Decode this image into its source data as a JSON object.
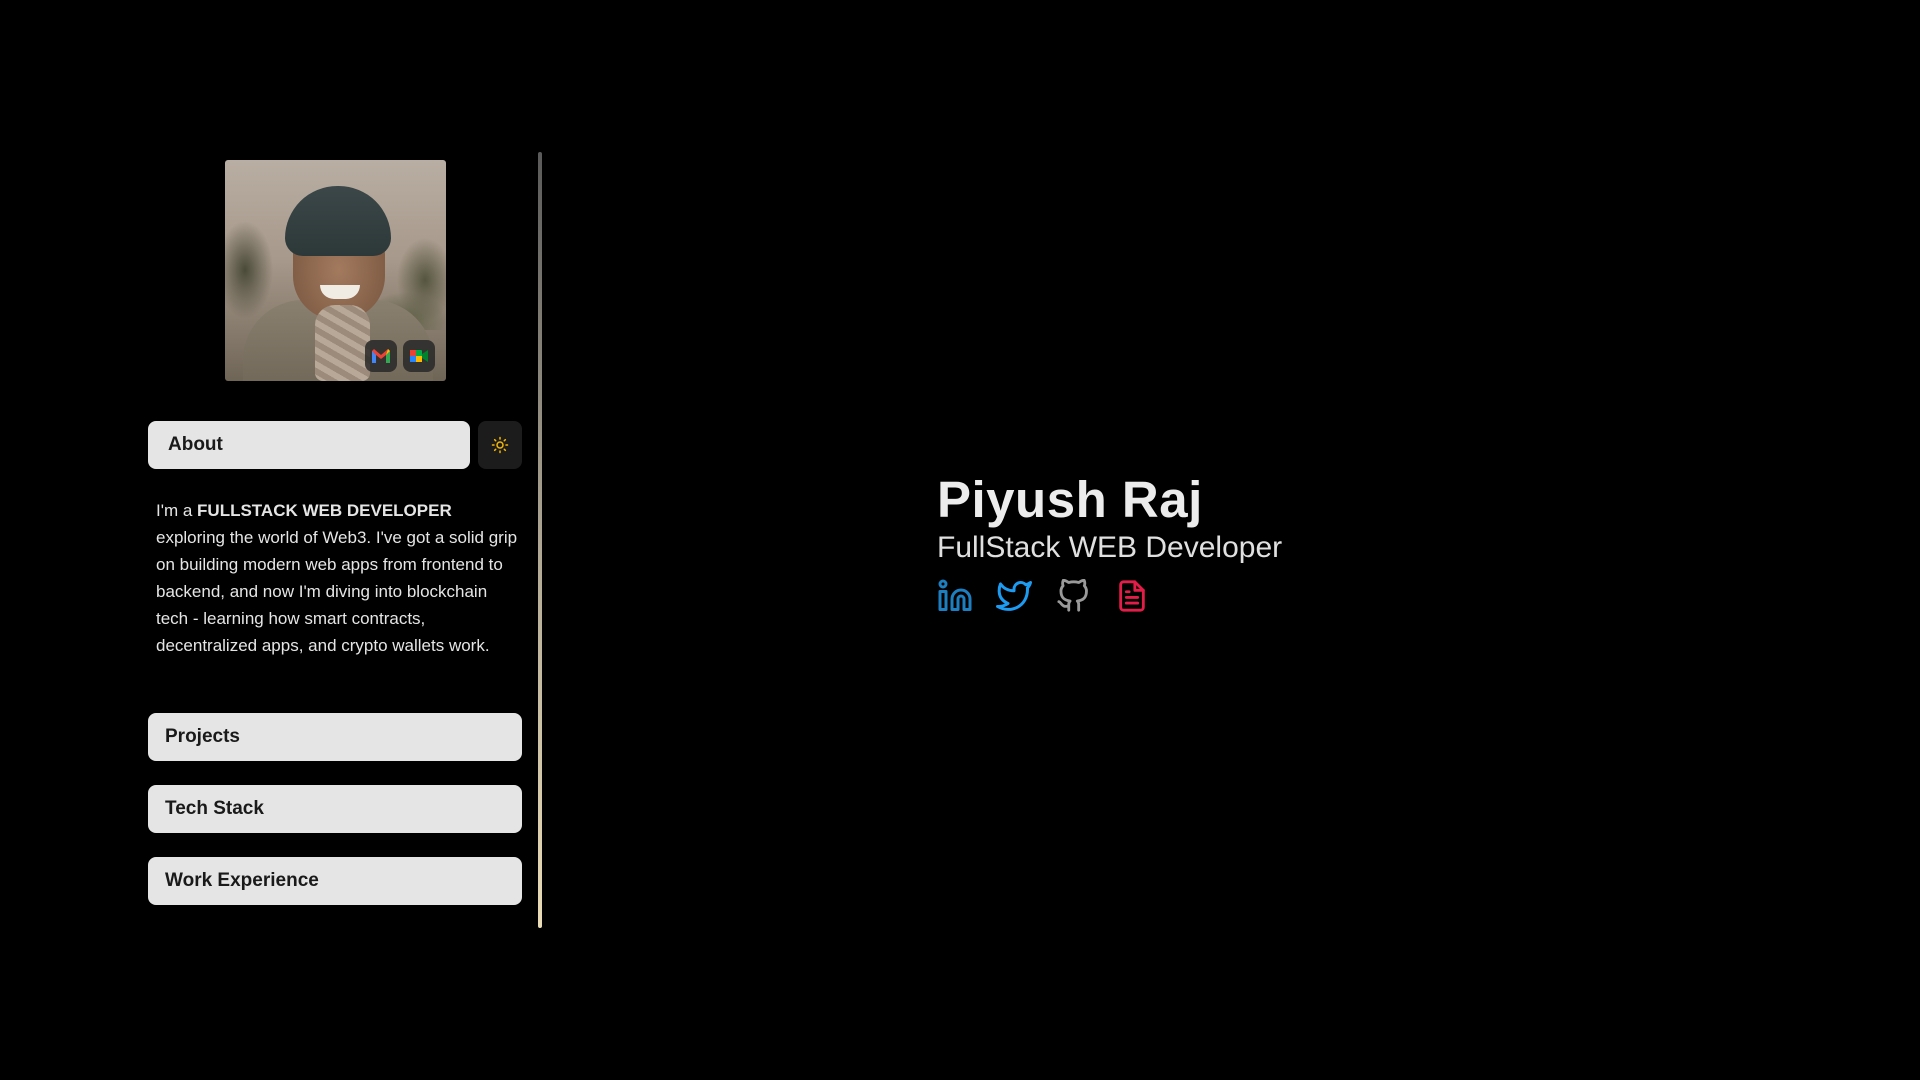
{
  "sidebar": {
    "about_label": "About",
    "about_text_prefix": "I'm a ",
    "about_text_highlight": "FULLSTACK WEB DEVELOPER",
    "about_text_rest": " exploring the world of Web3. I've got a solid grip on building modern web apps from frontend to backend, and now I'm diving into blockchain tech - learning how smart contracts, decentralized apps, and crypto wallets work.",
    "items": [
      {
        "label": "Projects"
      },
      {
        "label": "Tech Stack"
      },
      {
        "label": "Work Experience"
      }
    ],
    "theme_icon": "sun-icon",
    "avatar_badges": [
      "gmail-icon",
      "google-meet-icon"
    ]
  },
  "hero": {
    "name": "Piyush Raj",
    "role": "FullStack WEB Developer",
    "socials": [
      {
        "icon": "linkedin-icon",
        "color": "#1d7ec0"
      },
      {
        "icon": "twitter-icon",
        "color": "#1d9bf0"
      },
      {
        "icon": "github-icon",
        "color": "#9a9a9a"
      },
      {
        "icon": "resume-icon",
        "color": "#e11d48"
      }
    ]
  },
  "colors": {
    "background": "#000000",
    "button_bg": "#e5e5e5",
    "button_text": "#1a1a1a",
    "theme_accent": "#f5b700"
  }
}
